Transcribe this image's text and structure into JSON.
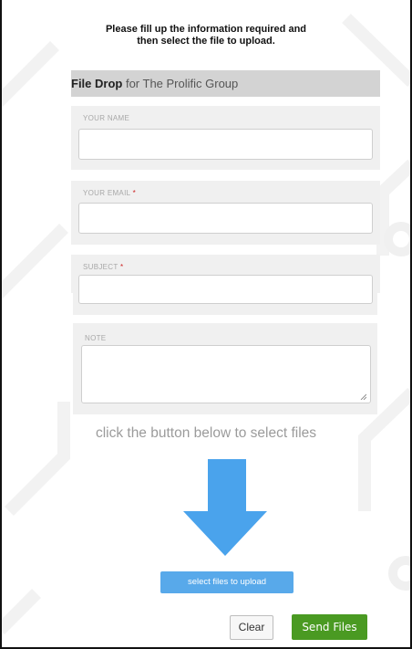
{
  "intro": {
    "line1": "Please fill up the information required and",
    "line2": "then select the file to upload."
  },
  "header": {
    "title_bold": "File Drop",
    "title_rest": " for The Prolific Group"
  },
  "form": {
    "name_label": "YOUR NAME",
    "email_label": "YOUR EMAIL ",
    "subject_label": "SUBJECT ",
    "note_label": "NOTE",
    "required_mark": "*"
  },
  "hint": "click the button below to select files",
  "buttons": {
    "select_files": "select files to upload",
    "clear": "Clear",
    "send": "Send Files"
  },
  "colors": {
    "header_bg": "#d3d3d3",
    "select_button": "#58a9ea",
    "send_button": "#4a9a22",
    "arrow": "#4aa3ec",
    "required": "#cc2222"
  },
  "icons": [
    "down-arrow-icon",
    "resize-grip-icon"
  ]
}
